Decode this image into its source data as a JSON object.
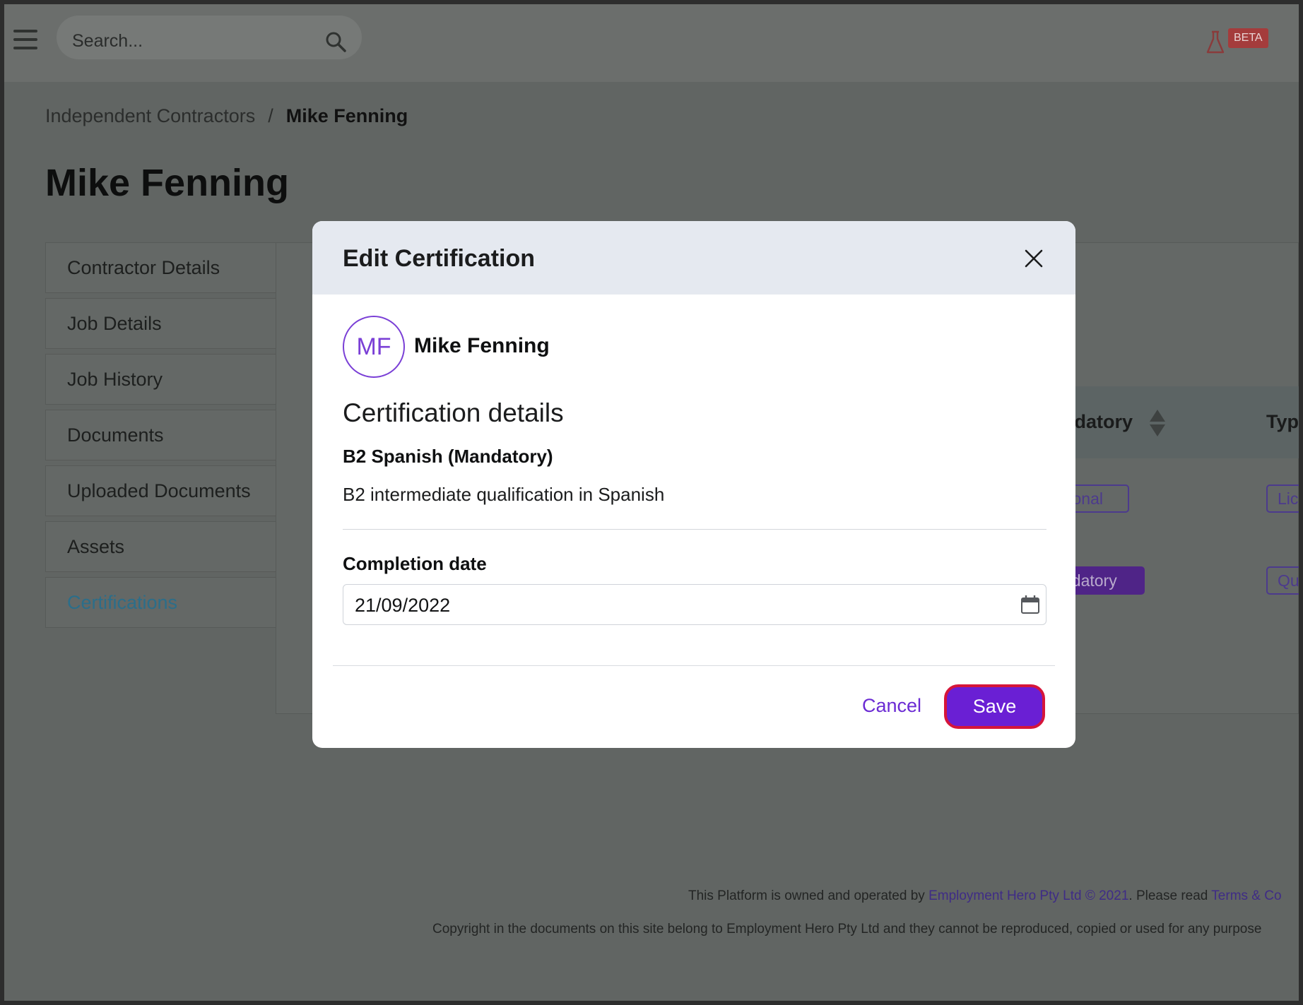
{
  "topbar": {
    "search_placeholder": "Search...",
    "beta_label": "BETA"
  },
  "breadcrumb": {
    "parent": "Independent Contractors",
    "separator": "/",
    "current": "Mike Fenning"
  },
  "page_title": "Mike Fenning",
  "sidebar": {
    "items": [
      {
        "label": "Contractor Details"
      },
      {
        "label": "Job Details"
      },
      {
        "label": "Job History"
      },
      {
        "label": "Documents"
      },
      {
        "label": "Uploaded Documents"
      },
      {
        "label": "Assets"
      },
      {
        "label": "Certifications"
      }
    ],
    "active_index": 6
  },
  "table_partial": {
    "header_mandatory": "ndatory",
    "header_type": "Typ",
    "row1_mandatory": "tional",
    "row1_type": "Lic",
    "row2_mandatory": "ndatory",
    "row2_type": "Qu"
  },
  "footer": {
    "line1_prefix": "This Platform is owned and operated by ",
    "line1_company": "Employment Hero Pty Ltd © 2021",
    "line1_middle": ". Please read ",
    "line1_link": "Terms & Co",
    "line2": "Copyright in the documents on this site belong to Employment Hero Pty Ltd and they cannot be reproduced, copied or used for any purpose"
  },
  "modal": {
    "title": "Edit Certification",
    "avatar_initials": "MF",
    "person_name": "Mike Fenning",
    "section_heading": "Certification details",
    "certification_name": "B2 Spanish (Mandatory)",
    "certification_description": "B2 intermediate qualification in Spanish",
    "date_label": "Completion date",
    "date_value": "21/09/2022",
    "cancel_label": "Cancel",
    "save_label": "Save"
  },
  "colors": {
    "accent": "#6a1fd4",
    "highlight_border": "#d6153a",
    "overlay": "#616563",
    "modal_header": "#e5e9f0"
  },
  "icons": [
    "hamburger-menu-icon",
    "search-icon",
    "beta-flask-icon",
    "sort-icon",
    "close-icon",
    "calendar-icon"
  ]
}
